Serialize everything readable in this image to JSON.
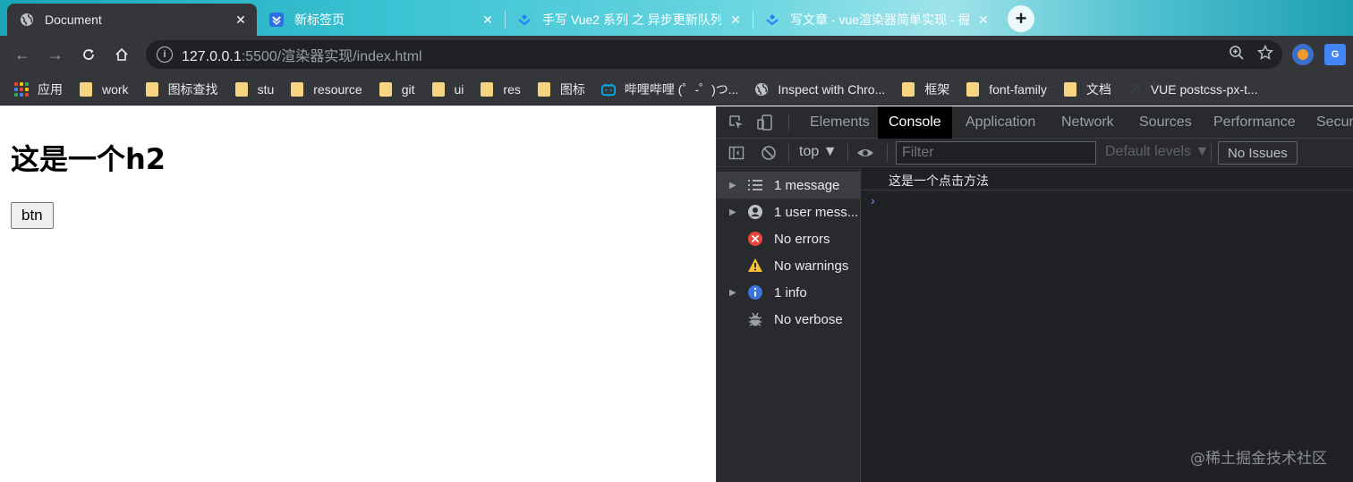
{
  "tabs": [
    {
      "title": "Document",
      "active": true
    },
    {
      "title": "新标签页",
      "active": false
    },
    {
      "title": "手写 Vue2 系列 之 异步更新队列",
      "active": false
    },
    {
      "title": "写文章 - vue渲染器简单实现 - 掘",
      "active": false
    }
  ],
  "new_tab_label": "+",
  "toolbar": {
    "url_host": "127.0.0.1",
    "url_rest": ":5500/渲染器实现/index.html",
    "ext2_label": "G"
  },
  "bookmarks": [
    {
      "label": "应用",
      "icon": "apps-grid-icon"
    },
    {
      "label": "work",
      "icon": "folder-icon"
    },
    {
      "label": "图标查找",
      "icon": "folder-icon"
    },
    {
      "label": "stu",
      "icon": "folder-icon"
    },
    {
      "label": "resource",
      "icon": "folder-icon"
    },
    {
      "label": "git",
      "icon": "folder-icon"
    },
    {
      "label": "ui",
      "icon": "folder-icon"
    },
    {
      "label": "res",
      "icon": "folder-icon"
    },
    {
      "label": "图标",
      "icon": "folder-icon"
    },
    {
      "label": "哔哩哔哩 (゜-゜)つ...",
      "icon": "bilibili-icon"
    },
    {
      "label": "Inspect with Chro...",
      "icon": "globe-icon"
    },
    {
      "label": "框架",
      "icon": "folder-icon"
    },
    {
      "label": "font-family",
      "icon": "folder-icon"
    },
    {
      "label": "文档",
      "icon": "folder-icon"
    },
    {
      "label": "VUE postcss-px-t...",
      "icon": "arrow-icon"
    }
  ],
  "page": {
    "heading": "这是一个h2",
    "button_label": "btn"
  },
  "devtools": {
    "tabs": [
      {
        "label": "Elements",
        "active": false
      },
      {
        "label": "Console",
        "active": true
      },
      {
        "label": "Application",
        "active": false
      },
      {
        "label": "Network",
        "active": false
      },
      {
        "label": "Sources",
        "active": false
      },
      {
        "label": "Performance",
        "active": false
      },
      {
        "label": "Securi",
        "active": false
      }
    ],
    "context": "top ▼",
    "filter_placeholder": "Filter",
    "levels": "Default levels ▼",
    "issues": "No Issues",
    "sidebar": [
      {
        "label": "1 message",
        "icon": "list-icon",
        "expandable": true,
        "selected": true
      },
      {
        "label": "1 user mess...",
        "icon": "user-icon",
        "expandable": true,
        "selected": false
      },
      {
        "label": "No errors",
        "icon": "error-icon",
        "expandable": false,
        "selected": false
      },
      {
        "label": "No warnings",
        "icon": "warning-icon",
        "expandable": false,
        "selected": false
      },
      {
        "label": "1 info",
        "icon": "info-icon",
        "expandable": true,
        "selected": false
      },
      {
        "label": "No verbose",
        "icon": "bug-icon",
        "expandable": false,
        "selected": false
      }
    ],
    "log_message": "这是一个点击方法",
    "prompt": "›"
  },
  "watermark": "@稀土掘金技术社区"
}
